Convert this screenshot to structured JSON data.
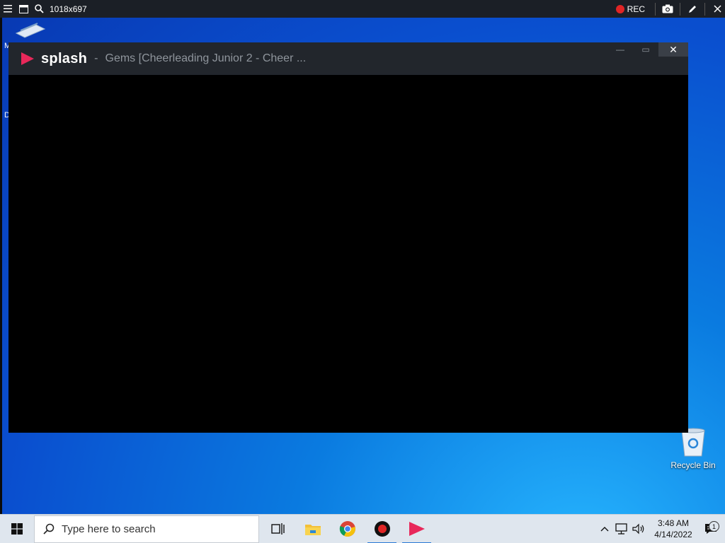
{
  "recorder_bar": {
    "resolution": "1018x697",
    "rec_label": "REC",
    "icons": [
      "menu-icon",
      "window-icon",
      "search-icon",
      "record-dot-icon",
      "camera-icon",
      "pen-icon",
      "close-icon"
    ],
    "rec_color": "#e02525"
  },
  "desktop": {
    "edge_letters": [
      "M",
      "D"
    ],
    "recycle_bin_label": "Recycle Bin"
  },
  "window": {
    "app_name": "splash",
    "separator": "-",
    "title": "Gems  [Cheerleading Junior 2 - Cheer ...",
    "controls": {
      "minimize": "—",
      "maximize": "▭",
      "close": "✕"
    },
    "logo_color": "#e8285a"
  },
  "taskbar": {
    "search_placeholder": "Type here to search",
    "apps": [
      "task-view-icon",
      "file-explorer-icon",
      "chrome-icon",
      "recorder-icon",
      "splash-icon"
    ],
    "clock_time": "3:48 AM",
    "clock_date": "4/14/2022",
    "notification_count": "1"
  }
}
